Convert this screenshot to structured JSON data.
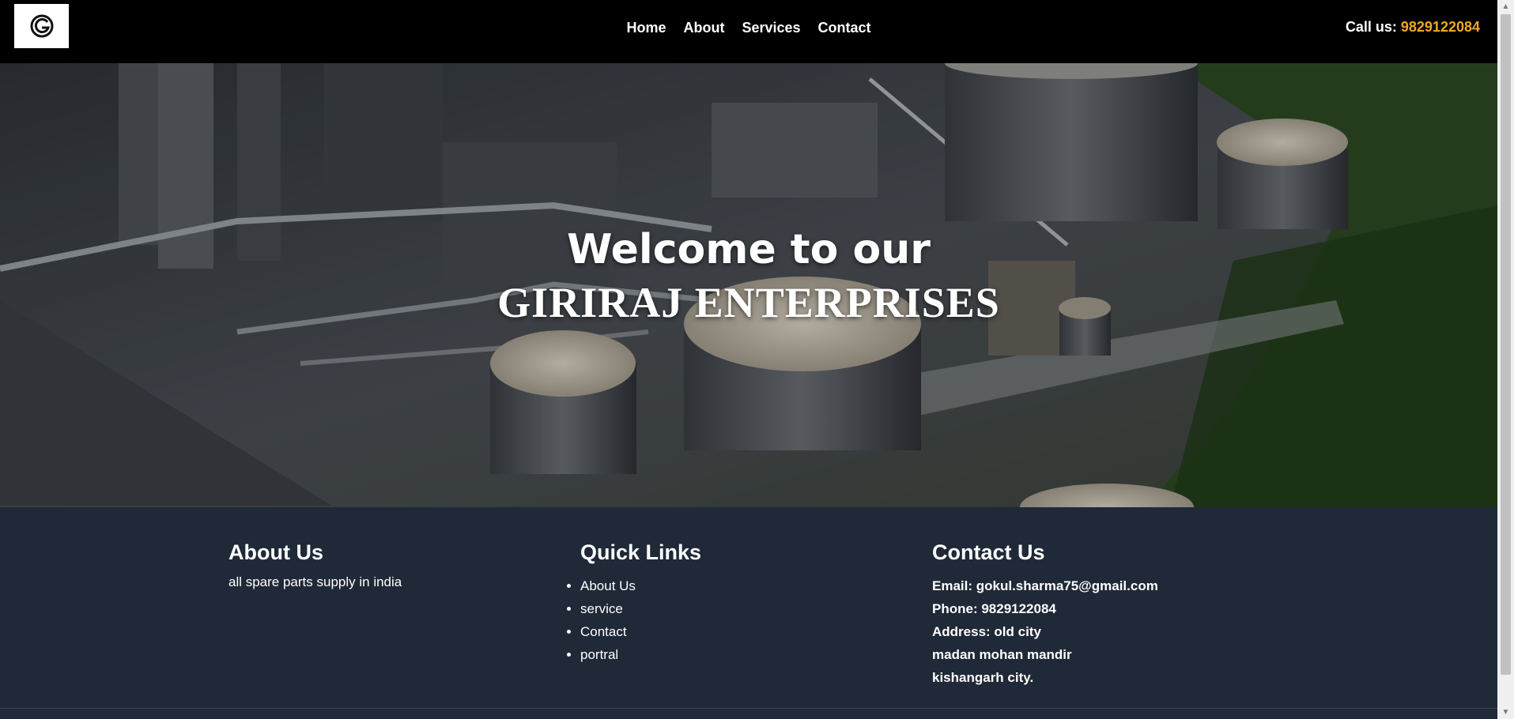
{
  "header": {
    "logo_icon": "g-circle-logo-icon",
    "nav": [
      {
        "label": "Home"
      },
      {
        "label": "About"
      },
      {
        "label": "Services"
      },
      {
        "label": "Contact"
      }
    ],
    "call_label": "Call us:",
    "call_number": "9829122084",
    "accent_color": "#f5a623"
  },
  "hero": {
    "welcome": "Welcome to our",
    "brand": "GIRIRAJ ENTERPRISES"
  },
  "footer": {
    "about": {
      "heading": "About Us",
      "text": "all spare parts supply in india"
    },
    "links": {
      "heading": "Quick Links",
      "items": [
        "About Us",
        "service",
        "Contact",
        "portral"
      ]
    },
    "contact": {
      "heading": "Contact Us",
      "email": "Email: gokul.sharma75@gmail.com",
      "phone": "Phone: 9829122084",
      "address1": "Address: old city",
      "address2": "madan mohan mandir",
      "address3": "kishangarh city."
    },
    "background_color": "#1f2937"
  }
}
